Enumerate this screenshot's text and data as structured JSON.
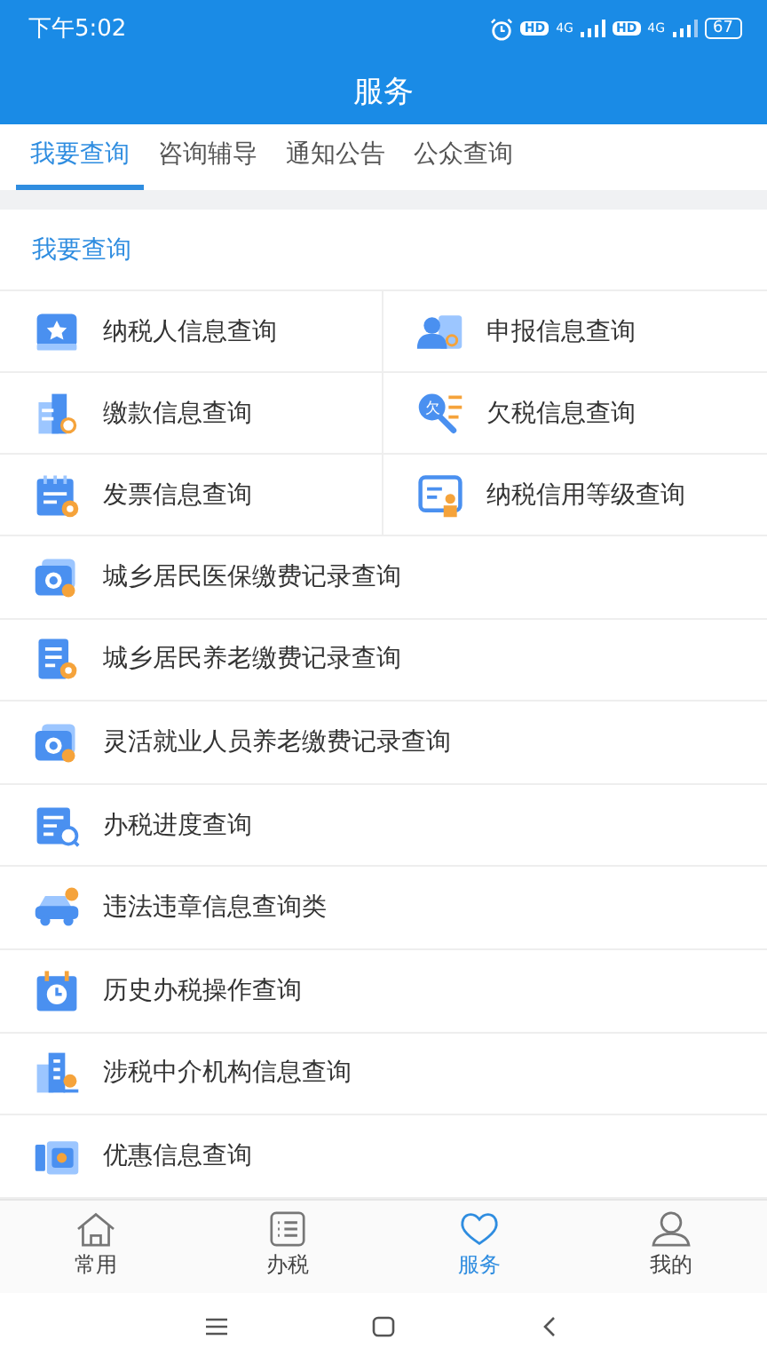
{
  "status_bar": {
    "time": "下午5:02",
    "sim_badges": [
      "HD",
      "HD"
    ],
    "network": [
      "4G",
      "4G"
    ],
    "battery": "67"
  },
  "header": {
    "title": "服务"
  },
  "tabs": [
    {
      "label": "我要查询",
      "selected": true
    },
    {
      "label": "咨询辅导",
      "selected": false
    },
    {
      "label": "通知公告",
      "selected": false
    },
    {
      "label": "公众查询",
      "selected": false
    }
  ],
  "section": {
    "title": "我要查询",
    "grid_items": [
      "纳税人信息查询",
      "申报信息查询",
      "缴款信息查询",
      "欠税信息查询",
      "发票信息查询",
      "纳税信用等级查询"
    ],
    "list_items": [
      "城乡居民医保缴费记录查询",
      "城乡居民养老缴费记录查询",
      "灵活就业人员养老缴费记录查询",
      "办税进度查询",
      "违法违章信息查询类",
      "历史办税操作查询",
      "涉税中介机构信息查询",
      "优惠信息查询"
    ]
  },
  "bottom_nav": [
    {
      "label": "常用",
      "selected": false
    },
    {
      "label": "办税",
      "selected": false
    },
    {
      "label": "服务",
      "selected": true
    },
    {
      "label": "我的",
      "selected": false
    }
  ],
  "icon_glyph": "欠"
}
